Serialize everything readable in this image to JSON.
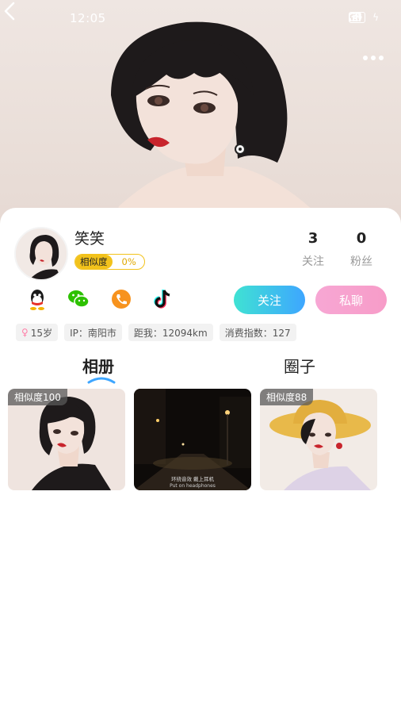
{
  "status_bar": {
    "time": "12:05",
    "battery": "26"
  },
  "profile": {
    "nickname": "笑笑",
    "similarity_label": "相似度",
    "similarity_value": "0%"
  },
  "stats": [
    {
      "count": "3",
      "label": "关注"
    },
    {
      "count": "0",
      "label": "粉丝"
    }
  ],
  "social_icons": [
    "qq-icon",
    "wechat-icon",
    "phone-icon",
    "tiktok-icon"
  ],
  "actions": {
    "follow_label": "关注",
    "chat_label": "私聊"
  },
  "tags": {
    "age": "15岁",
    "ip": "IP：南阳市",
    "distance": "距我：12094km",
    "spending": "消费指数：127"
  },
  "tabs": [
    {
      "label": "相册",
      "active": true
    },
    {
      "label": "圈子",
      "active": false
    }
  ],
  "photos": [
    {
      "badge": "相似度100"
    },
    {
      "badge": "",
      "caption_line1": "环绕音效 戴上耳机",
      "caption_line2": "Put on headphones"
    },
    {
      "badge": "相似度88"
    }
  ],
  "colors": {
    "follow_gradient": [
      "#3fe2d3",
      "#3ea6ff"
    ],
    "chat_gradient": [
      "#f7a7d4",
      "#f79cc8"
    ],
    "badge_yellow": "#f2c21b",
    "tab_indicator": "#3ea6ff"
  }
}
